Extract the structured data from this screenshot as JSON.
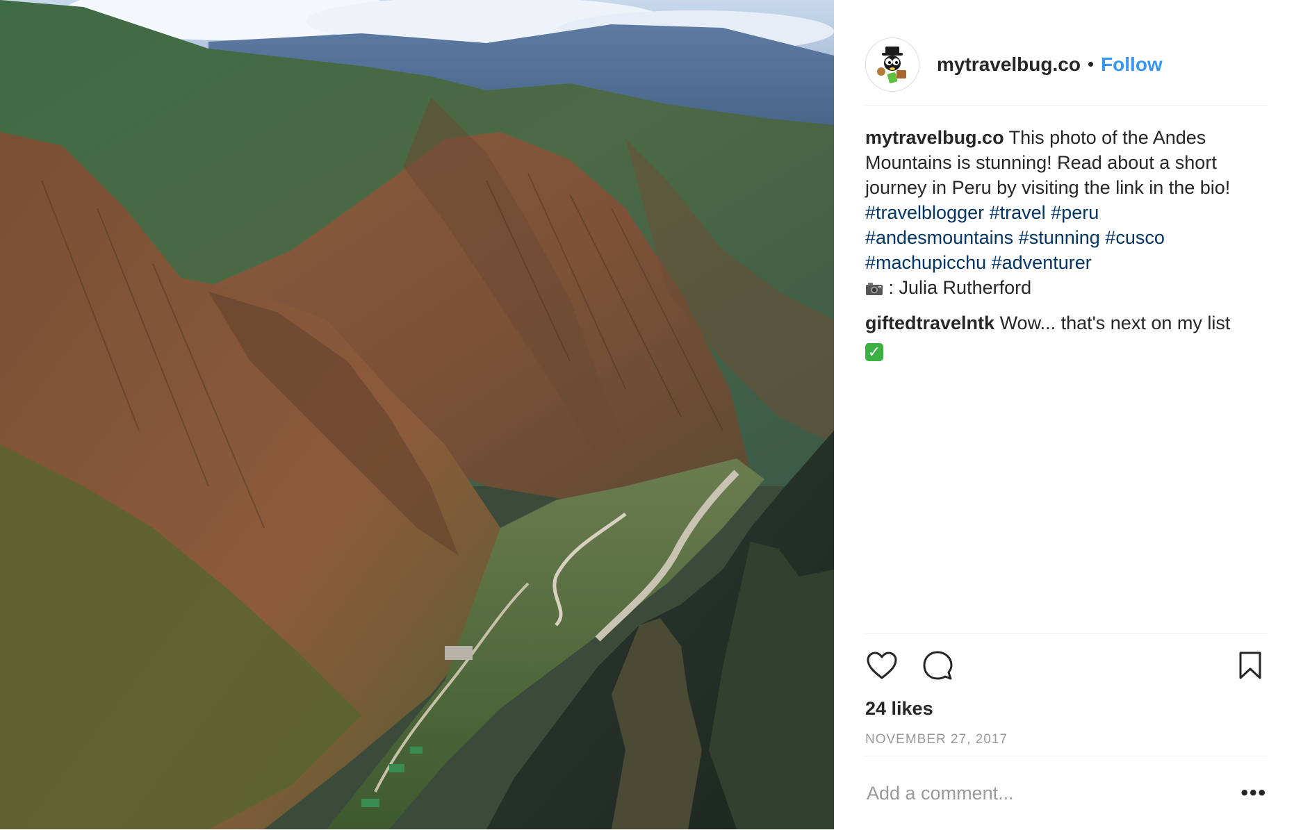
{
  "post": {
    "username": "mytravelbug.co",
    "separator": "•",
    "follow_label": "Follow",
    "caption": {
      "username": "mytravelbug.co",
      "text": "This photo of the Andes Mountains is stunning! Read about a short journey in Peru by visiting the link in the bio!",
      "hashtags": [
        "#travelblogger",
        "#travel",
        "#peru",
        "#andesmountains",
        "#stunning",
        "#cusco",
        "#machupicchu",
        "#adventurer"
      ],
      "credit": ": Julia Rutherford",
      "credit_icon": "camera-icon"
    },
    "comments": [
      {
        "username": "giftedtravelntk",
        "text": "Wow... that's next on my list",
        "emoji_icon": "check-mark-icon"
      }
    ],
    "likes": "24 likes",
    "date": "NOVEMBER 27, 2017",
    "add_comment_placeholder": "Add a comment...",
    "more_label": "•••",
    "icons": {
      "like": "heart-icon",
      "comment": "comment-bubble-icon",
      "save": "bookmark-icon"
    },
    "colors": {
      "link_blue": "#3897f0",
      "hashtag_blue": "#003569",
      "text": "#262626",
      "muted": "#999999"
    }
  },
  "photo": {
    "subject": "aerial-view-andes-mountain-valley"
  }
}
